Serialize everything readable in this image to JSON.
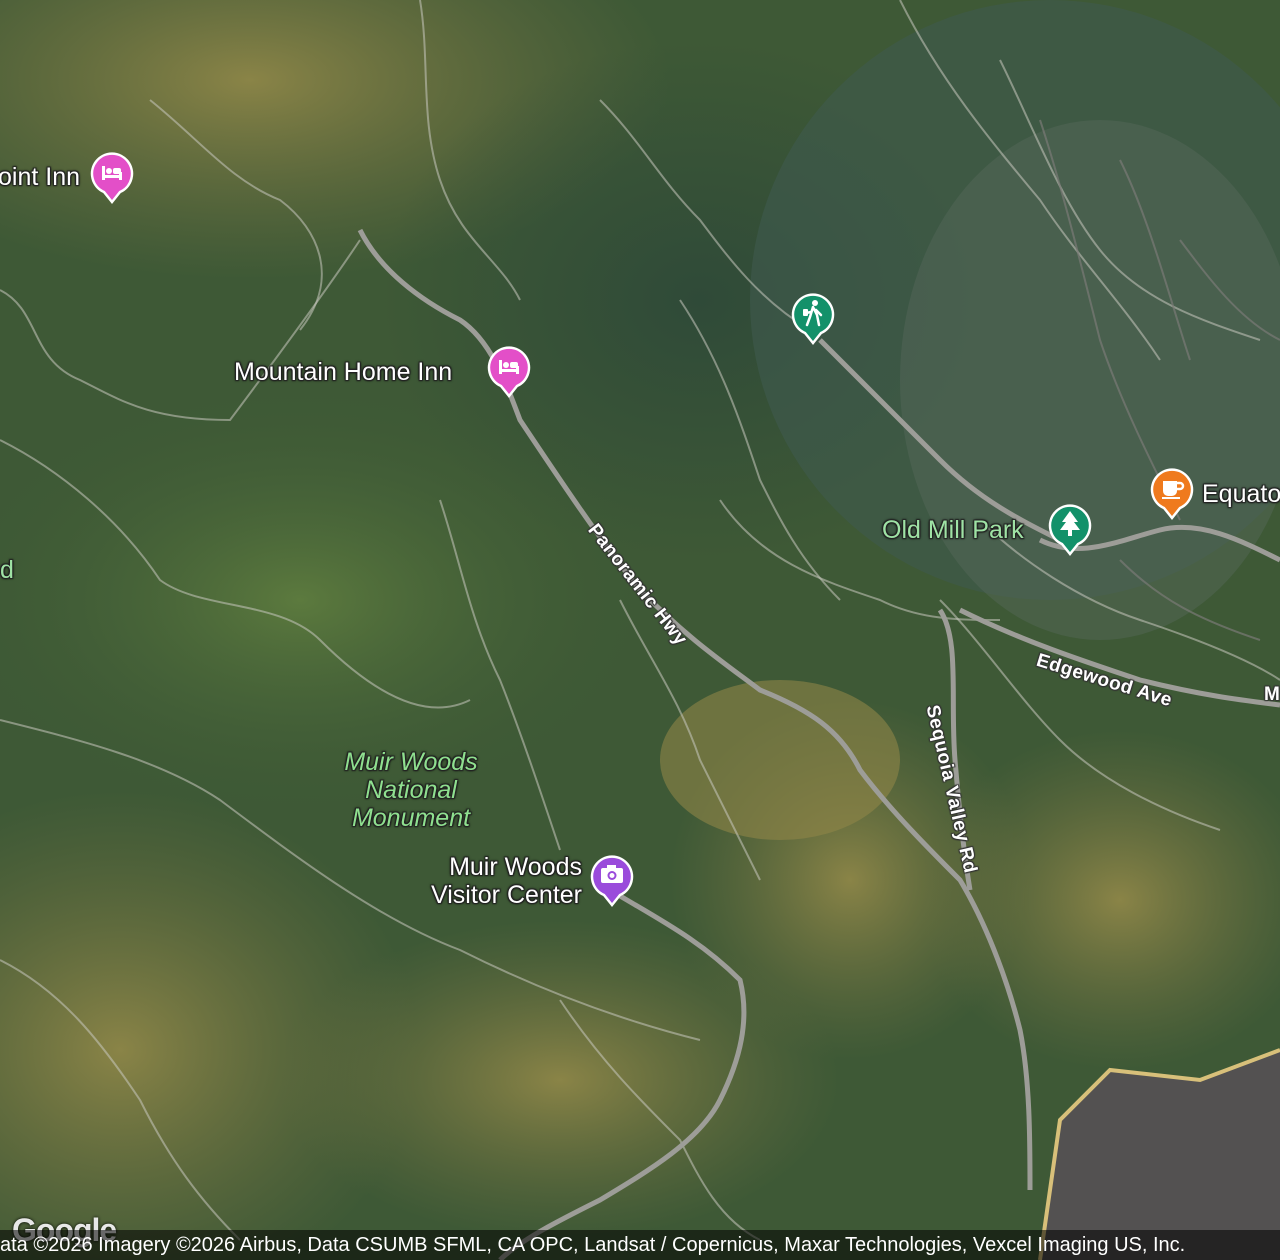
{
  "map": {
    "type": "satellite",
    "places": [
      {
        "name": "oint Inn",
        "category": "hotel"
      },
      {
        "name": "Mountain Home Inn",
        "category": "hotel"
      },
      {
        "name": "",
        "category": "hiking"
      },
      {
        "name": "Old Mill Park",
        "category": "park"
      },
      {
        "name": "Equato",
        "category": "cafe"
      },
      {
        "name": "Muir Woods\nVisitor Center",
        "category": "visitor-center"
      }
    ],
    "area_label": "Muir Woods\nNational\nMonument",
    "roads": [
      "Panoramic Hwy",
      "Edgewood Ave",
      "Sequoia Valley Rd"
    ],
    "edge_fragments": [
      "d",
      "M"
    ],
    "colors": {
      "hotel": "#e34fc8",
      "hiking": "#13916a",
      "park": "#13916a",
      "cafe": "#ef7a1d",
      "visitor": "#9a4bdb"
    }
  },
  "attribution": "ata ©2026 Imagery ©2026 Airbus, Data CSUMB SFML, CA OPC, Landsat / Copernicus, Maxar Technologies, Vexcel Imaging US, Inc.",
  "logo": "Google"
}
